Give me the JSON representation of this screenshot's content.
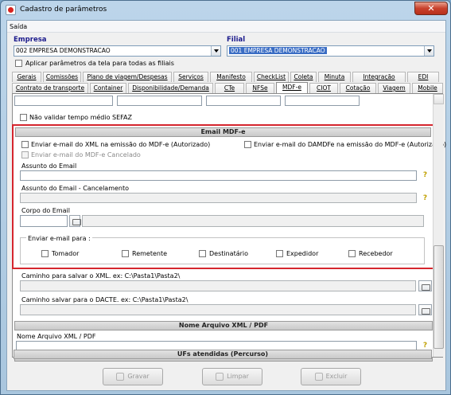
{
  "window": {
    "title": "Cadastro de parâmetros",
    "close_label": "✕"
  },
  "menu": {
    "saida": "Saída"
  },
  "header": {
    "empresa_label": "Empresa",
    "empresa_value": "002 EMPRESA DEMONSTRACAO",
    "filial_label": "Filial",
    "filial_value": "001 EMPRESA DEMONSTRACAO",
    "aplicar_label": "Aplicar parâmetros da tela para todas as filiais"
  },
  "tabs_row1": [
    "Gerais",
    "Comissões",
    "Plano de viagem/Despesas",
    "Serviços",
    "Manifesto",
    "CheckList",
    "Coleta",
    "Minuta",
    "Integração",
    "EDI"
  ],
  "tabs_row2": [
    "Contrato de transporte",
    "Container",
    "Disponibilidade/Demanda",
    "CTe",
    "NFSe",
    "MDF-e",
    "CIOT",
    "Cotação",
    "Viagem",
    "Mobile"
  ],
  "mdfe": {
    "nao_validar": "Não validar tempo médio SEFAZ",
    "email_header": "Email MDF-e",
    "enviar_xml": "Enviar e-mail do XML na emissão do MDF-e (Autorizado)",
    "enviar_damdfe": "Enviar e-mail do DAMDFe na emissão do MDF-e (Autorizado)",
    "enviar_cancelado": "Enviar e-mail do MDF-e Cancelado",
    "assunto_label": "Assunto do Email",
    "assunto_cancel_label": "Assunto do Email - Cancelamento",
    "corpo_label": "Corpo do Email",
    "enviar_para": "Enviar e-mail para :",
    "destinatarios": [
      "Tomador",
      "Remetente",
      "Destinatário",
      "Expedidor",
      "Recebedor"
    ],
    "caminho_xml": "Caminho para salvar o XML. ex: C:\\Pasta1\\Pasta2\\",
    "caminho_dacte": "Caminho salvar para o DACTE. ex: C:\\Pasta1\\Pasta2\\",
    "nome_arquivo_header": "Nome Arquivo XML / PDF",
    "nome_arquivo_label": "Nome Arquivo XML / PDF",
    "ufs_header": "UFs atendidas (Percurso)",
    "help": "?"
  },
  "footer": {
    "gravar": "Gravar",
    "limpar": "Limpar",
    "excluir": "Excluir"
  },
  "colors": {
    "highlight": "#d5262e",
    "selection": "#3a6dc4"
  }
}
